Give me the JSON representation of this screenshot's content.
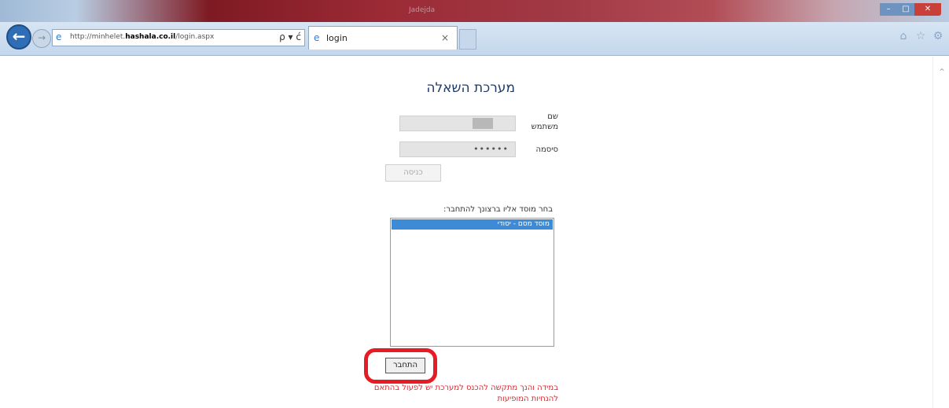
{
  "browser": {
    "window_title": "Jadejda",
    "url_prefix": "http://minhelet.",
    "url_domain": "hashala.co.il",
    "url_path": "/login.aspx",
    "address_tools": "ρ ▾ ć",
    "tab_title": "login",
    "tab_close": "×",
    "back_arrow": "←",
    "forward_arrow": "→"
  },
  "page": {
    "title": "מערכת השאלה",
    "username_label": "שם משתמש",
    "password_label": "סיסמה",
    "password_value": "••••••",
    "login_button": "כניסה",
    "choose_label": "בחר מוסד אליו ברצונך להתחבר:",
    "list_items": [
      "מוסד מסם - יסודי"
    ],
    "connect_button": "התחבר",
    "warning": "במידה והנך מתקשה להכנס למערכת יש לפעול בהתאם להנחיות המופיעות"
  },
  "colors": {
    "title": "#1f3c66",
    "warning": "#e0272d",
    "highlight_ring": "#e51c24",
    "list_selection": "#3d8bd6"
  }
}
